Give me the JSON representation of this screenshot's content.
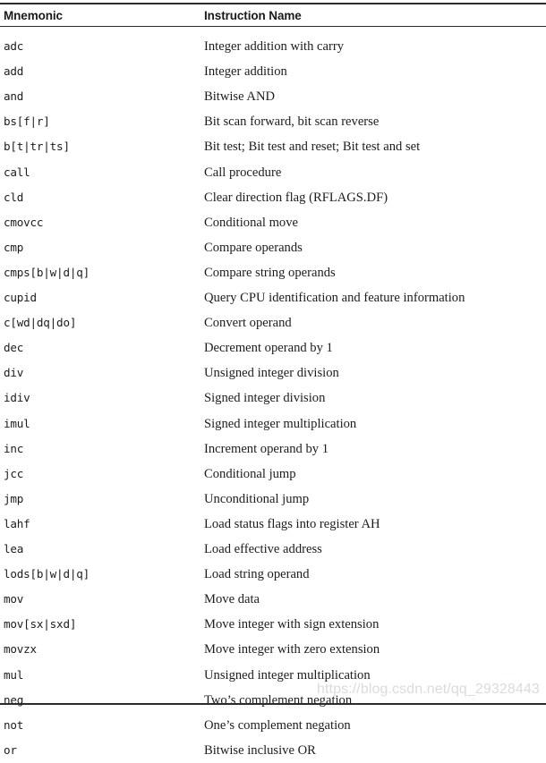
{
  "document": {
    "type": "reference-table",
    "background_color": "#ffffff",
    "text_color": "#1c1c1c",
    "rule_color": "#2b2b2b"
  },
  "table": {
    "columns": [
      {
        "key": "mnemonic",
        "label": "Mnemonic"
      },
      {
        "key": "instruction_name",
        "label": "Instruction Name"
      }
    ],
    "rows": [
      {
        "mnemonic": "adc",
        "instruction_name": "Integer addition with carry"
      },
      {
        "mnemonic": "add",
        "instruction_name": "Integer addition"
      },
      {
        "mnemonic": "and",
        "instruction_name": "Bitwise AND"
      },
      {
        "mnemonic": "bs[f|r]",
        "instruction_name": "Bit scan forward, bit scan reverse"
      },
      {
        "mnemonic": "b[t|tr|ts]",
        "instruction_name": "Bit test; Bit test and reset; Bit test and set"
      },
      {
        "mnemonic": "call",
        "instruction_name": "Call procedure"
      },
      {
        "mnemonic": "cld",
        "instruction_name": "Clear direction flag (RFLAGS.DF)"
      },
      {
        "mnemonic": "cmovcc",
        "instruction_name": "Conditional move"
      },
      {
        "mnemonic": "cmp",
        "instruction_name": "Compare operands"
      },
      {
        "mnemonic": "cmps[b|w|d|q]",
        "instruction_name": "Compare string operands"
      },
      {
        "mnemonic": "cupid",
        "instruction_name": "Query CPU identification and feature information"
      },
      {
        "mnemonic": "c[wd|dq|do]",
        "instruction_name": "Convert operand"
      },
      {
        "mnemonic": "dec",
        "instruction_name": "Decrement operand by 1"
      },
      {
        "mnemonic": "div",
        "instruction_name": "Unsigned integer division"
      },
      {
        "mnemonic": "idiv",
        "instruction_name": "Signed integer division"
      },
      {
        "mnemonic": "imul",
        "instruction_name": "Signed integer multiplication"
      },
      {
        "mnemonic": "inc",
        "instruction_name": "Increment operand by 1"
      },
      {
        "mnemonic": "jcc",
        "instruction_name": "Conditional jump"
      },
      {
        "mnemonic": "jmp",
        "instruction_name": "Unconditional jump"
      },
      {
        "mnemonic": "lahf",
        "instruction_name": "Load status flags into register AH"
      },
      {
        "mnemonic": "lea",
        "instruction_name": "Load effective address"
      },
      {
        "mnemonic": "lods[b|w|d|q]",
        "instruction_name": "Load string operand"
      },
      {
        "mnemonic": "mov",
        "instruction_name": "Move data"
      },
      {
        "mnemonic": "mov[sx|sxd]",
        "instruction_name": "Move integer with sign extension"
      },
      {
        "mnemonic": "movzx",
        "instruction_name": "Move integer with zero extension"
      },
      {
        "mnemonic": "mul",
        "instruction_name": "Unsigned integer multiplication"
      },
      {
        "mnemonic": "neg",
        "instruction_name": "Two’s complement negation"
      },
      {
        "mnemonic": "not",
        "instruction_name": "One’s complement negation"
      },
      {
        "mnemonic": "or",
        "instruction_name": "Bitwise inclusive OR"
      }
    ]
  },
  "watermark": {
    "text": "https://blog.csdn.net/qq_29328443",
    "color": "#d8dbe0"
  }
}
